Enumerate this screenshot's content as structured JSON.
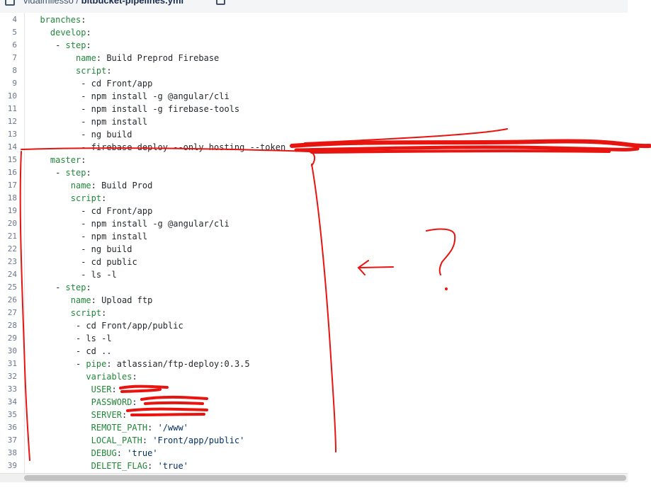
{
  "breadcrumb": {
    "repo": "vidalmilesso",
    "separator": " / ",
    "file": "bitbucket-pipelines.yml"
  },
  "editor": {
    "lines": [
      {
        "n": "4",
        "indent": 2,
        "key": "branches",
        "sep": ":",
        "val": ""
      },
      {
        "n": "5",
        "indent": 4,
        "key": "develop",
        "sep": ":",
        "val": ""
      },
      {
        "n": "6",
        "indent": 5,
        "dash": "- ",
        "key": "step",
        "sep": ":",
        "val": ""
      },
      {
        "n": "7",
        "indent": 9,
        "key": "name",
        "sep": ": ",
        "val": "Build Preprod Firebase"
      },
      {
        "n": "8",
        "indent": 9,
        "key": "script",
        "sep": ":",
        "val": ""
      },
      {
        "n": "9",
        "indent": 10,
        "dash": "- ",
        "val": "cd Front/app"
      },
      {
        "n": "10",
        "indent": 10,
        "dash": "- ",
        "val": "npm install -g @angular/cli"
      },
      {
        "n": "11",
        "indent": 10,
        "dash": "- ",
        "val": "npm install -g firebase-tools"
      },
      {
        "n": "12",
        "indent": 10,
        "dash": "- ",
        "val": "npm install"
      },
      {
        "n": "13",
        "indent": 10,
        "dash": "- ",
        "val": "ng build"
      },
      {
        "n": "14",
        "indent": 10,
        "dash": "- ",
        "val": "firebase deploy --only hosting --token \""
      },
      {
        "n": "15",
        "indent": 4,
        "key": "master",
        "sep": ":",
        "val": ""
      },
      {
        "n": "16",
        "indent": 5,
        "dash": "- ",
        "key": "step",
        "sep": ":",
        "val": ""
      },
      {
        "n": "17",
        "indent": 8,
        "key": "name",
        "sep": ": ",
        "val": "Build Prod"
      },
      {
        "n": "18",
        "indent": 8,
        "key": "script",
        "sep": ":",
        "val": ""
      },
      {
        "n": "19",
        "indent": 10,
        "dash": "- ",
        "val": "cd Front/app"
      },
      {
        "n": "20",
        "indent": 10,
        "dash": "- ",
        "val": "npm install -g @angular/cli"
      },
      {
        "n": "21",
        "indent": 10,
        "dash": "- ",
        "val": "npm install"
      },
      {
        "n": "22",
        "indent": 10,
        "dash": "- ",
        "val": "ng build"
      },
      {
        "n": "23",
        "indent": 10,
        "dash": "- ",
        "val": "cd public"
      },
      {
        "n": "24",
        "indent": 10,
        "dash": "- ",
        "val": "ls -l"
      },
      {
        "n": "25",
        "indent": 5,
        "dash": "- ",
        "key": "step",
        "sep": ":",
        "val": ""
      },
      {
        "n": "26",
        "indent": 8,
        "key": "name",
        "sep": ": ",
        "val": "Upload ftp"
      },
      {
        "n": "27",
        "indent": 8,
        "key": "script",
        "sep": ":",
        "val": ""
      },
      {
        "n": "28",
        "indent": 9,
        "dash": "- ",
        "val": "cd Front/app/public"
      },
      {
        "n": "29",
        "indent": 9,
        "dash": "- ",
        "val": "ls -l"
      },
      {
        "n": "30",
        "indent": 9,
        "dash": "- ",
        "val": "cd .."
      },
      {
        "n": "31",
        "indent": 9,
        "dash": "- ",
        "key": "pipe",
        "sep": ": ",
        "val": "atlassian/ftp-deploy:0.3.5"
      },
      {
        "n": "32",
        "indent": 11,
        "key": "variables",
        "sep": ":",
        "val": ""
      },
      {
        "n": "33",
        "indent": 12,
        "key": "USER",
        "sep": ": ",
        "val": ""
      },
      {
        "n": "34",
        "indent": 12,
        "key": "PASSWORD",
        "sep": ": ",
        "val": ""
      },
      {
        "n": "35",
        "indent": 12,
        "key": "SERVER",
        "sep": ": ",
        "val": ""
      },
      {
        "n": "36",
        "indent": 12,
        "key": "REMOTE_PATH",
        "sep": ": ",
        "val": "'/www'"
      },
      {
        "n": "37",
        "indent": 12,
        "key": "LOCAL_PATH",
        "sep": ": ",
        "val": "'Front/app/public'"
      },
      {
        "n": "38",
        "indent": 12,
        "key": "DEBUG",
        "sep": ": ",
        "val": "'true'"
      },
      {
        "n": "39",
        "indent": 12,
        "key": "DELETE_FLAG",
        "sep": ": ",
        "val": "'true'"
      }
    ]
  },
  "annotation": {
    "color": "#e8140f",
    "question_mark": "?"
  },
  "colors": {
    "key": "#22863a",
    "line_number": "#6b778c",
    "text": "#24292e"
  }
}
